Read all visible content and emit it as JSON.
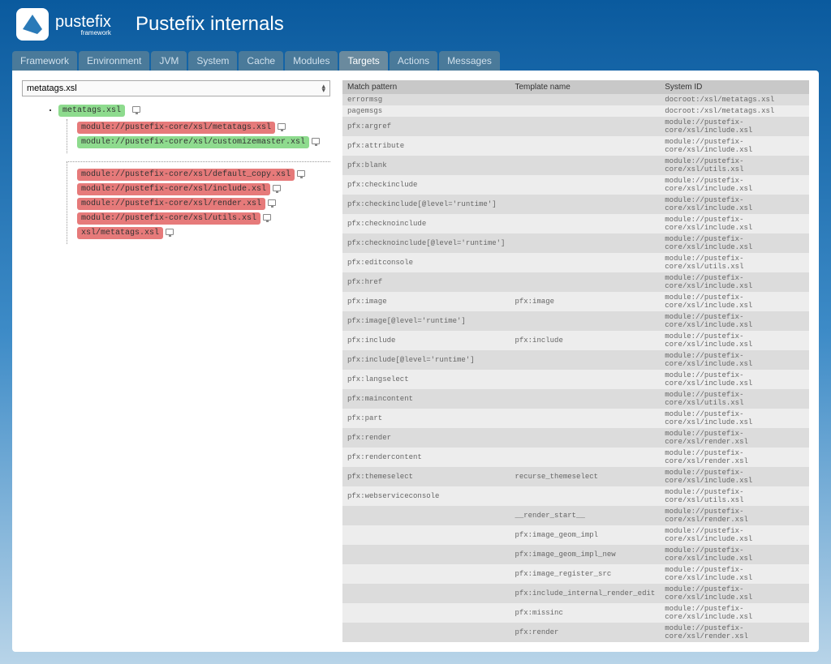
{
  "brand": {
    "name": "pustefix",
    "sub": "framework"
  },
  "page_title": "Pustefix internals",
  "tabs": [
    "Framework",
    "Environment",
    "JVM",
    "System",
    "Cache",
    "Modules",
    "Targets",
    "Actions",
    "Messages"
  ],
  "active_tab": "Targets",
  "selector_value": "metatags.xsl",
  "tree": {
    "root": "metatags.xsl",
    "group1": [
      {
        "label": "module://pustefix-core/xsl/metatags.xsl",
        "color": "red"
      },
      {
        "label": "module://pustefix-core/xsl/customizemaster.xsl",
        "color": "green"
      }
    ],
    "group2": [
      {
        "label": "module://pustefix-core/xsl/default_copy.xsl",
        "color": "red"
      },
      {
        "label": "module://pustefix-core/xsl/include.xsl",
        "color": "red"
      },
      {
        "label": "module://pustefix-core/xsl/render.xsl",
        "color": "red"
      },
      {
        "label": "module://pustefix-core/xsl/utils.xsl",
        "color": "red"
      },
      {
        "label": "xsl/metatags.xsl",
        "color": "red"
      }
    ]
  },
  "table": {
    "headers": [
      "Match pattern",
      "Template name",
      "System ID"
    ],
    "rows": [
      [
        "errormsg",
        "",
        "docroot:/xsl/metatags.xsl"
      ],
      [
        "pagemsgs",
        "",
        "docroot:/xsl/metatags.xsl"
      ],
      [
        "pfx:argref",
        "",
        "module://pustefix-core/xsl/include.xsl"
      ],
      [
        "pfx:attribute",
        "",
        "module://pustefix-core/xsl/include.xsl"
      ],
      [
        "pfx:blank",
        "",
        "module://pustefix-core/xsl/utils.xsl"
      ],
      [
        "pfx:checkinclude",
        "",
        "module://pustefix-core/xsl/include.xsl"
      ],
      [
        "pfx:checkinclude[@level='runtime']",
        "",
        "module://pustefix-core/xsl/include.xsl"
      ],
      [
        "pfx:checknoinclude",
        "",
        "module://pustefix-core/xsl/include.xsl"
      ],
      [
        "pfx:checknoinclude[@level='runtime']",
        "",
        "module://pustefix-core/xsl/include.xsl"
      ],
      [
        "pfx:editconsole",
        "",
        "module://pustefix-core/xsl/utils.xsl"
      ],
      [
        "pfx:href",
        "",
        "module://pustefix-core/xsl/include.xsl"
      ],
      [
        "pfx:image",
        "pfx:image",
        "module://pustefix-core/xsl/include.xsl"
      ],
      [
        "pfx:image[@level='runtime']",
        "",
        "module://pustefix-core/xsl/include.xsl"
      ],
      [
        "pfx:include",
        "pfx:include",
        "module://pustefix-core/xsl/include.xsl"
      ],
      [
        "pfx:include[@level='runtime']",
        "",
        "module://pustefix-core/xsl/include.xsl"
      ],
      [
        "pfx:langselect",
        "",
        "module://pustefix-core/xsl/include.xsl"
      ],
      [
        "pfx:maincontent",
        "",
        "module://pustefix-core/xsl/utils.xsl"
      ],
      [
        "pfx:part",
        "",
        "module://pustefix-core/xsl/include.xsl"
      ],
      [
        "pfx:render",
        "",
        "module://pustefix-core/xsl/render.xsl"
      ],
      [
        "pfx:rendercontent",
        "",
        "module://pustefix-core/xsl/render.xsl"
      ],
      [
        "pfx:themeselect",
        "recurse_themeselect",
        "module://pustefix-core/xsl/include.xsl"
      ],
      [
        "pfx:webserviceconsole",
        "",
        "module://pustefix-core/xsl/utils.xsl"
      ],
      [
        "",
        "__render_start__",
        "module://pustefix-core/xsl/render.xsl"
      ],
      [
        "",
        "pfx:image_geom_impl",
        "module://pustefix-core/xsl/include.xsl"
      ],
      [
        "",
        "pfx:image_geom_impl_new",
        "module://pustefix-core/xsl/include.xsl"
      ],
      [
        "",
        "pfx:image_register_src",
        "module://pustefix-core/xsl/include.xsl"
      ],
      [
        "",
        "pfx:include_internal_render_edit",
        "module://pustefix-core/xsl/include.xsl"
      ],
      [
        "",
        "pfx:missinc",
        "module://pustefix-core/xsl/include.xsl"
      ],
      [
        "",
        "pfx:render",
        "module://pustefix-core/xsl/render.xsl"
      ]
    ]
  }
}
